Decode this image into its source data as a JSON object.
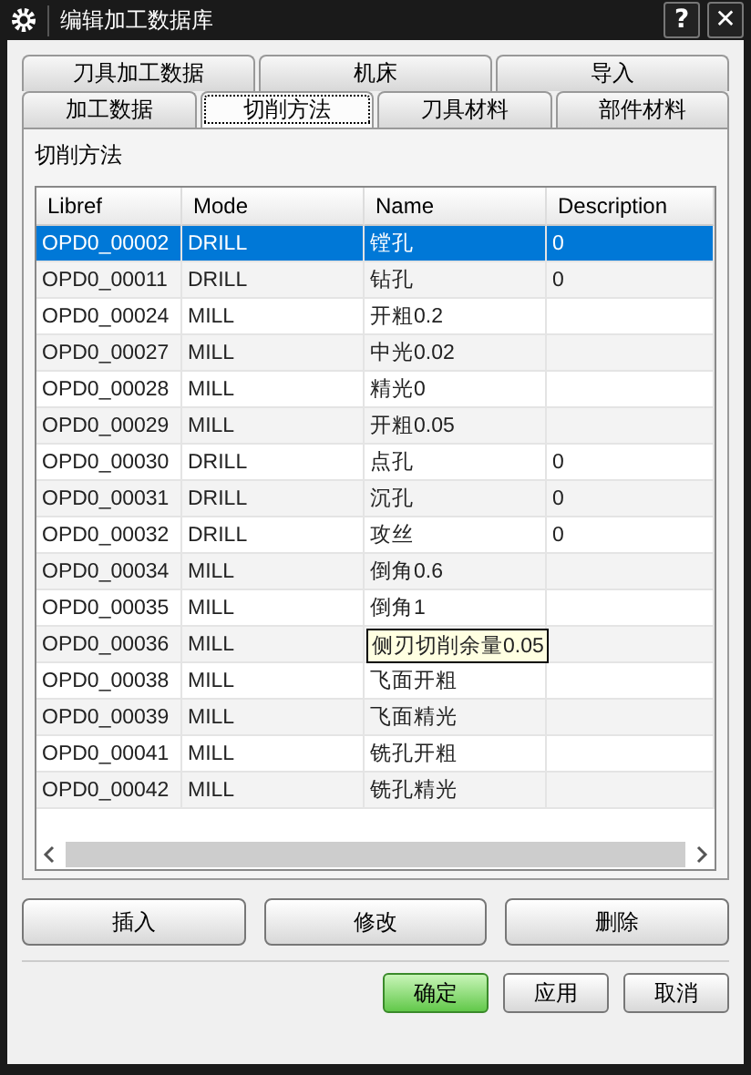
{
  "window": {
    "title": "编辑加工数据库",
    "help": "?",
    "close": "✕"
  },
  "tab_rows": [
    [
      {
        "label": "刀具加工数据",
        "selected": false
      },
      {
        "label": "机床",
        "selected": false
      },
      {
        "label": "导入",
        "selected": false
      }
    ],
    [
      {
        "label": "加工数据",
        "selected": false
      },
      {
        "label": "切削方法",
        "selected": true
      },
      {
        "label": "刀具材料",
        "selected": false
      },
      {
        "label": "部件材料",
        "selected": false
      }
    ]
  ],
  "group_label": "切削方法",
  "table": {
    "columns": [
      "Libref",
      "Mode",
      "Name",
      "Description"
    ],
    "rows": [
      {
        "cells": [
          "OPD0_00002",
          "DRILL",
          "镗孔",
          "0"
        ],
        "selected": true,
        "tooltip": false
      },
      {
        "cells": [
          "OPD0_00011",
          "DRILL",
          "钻孔",
          "0"
        ],
        "selected": false,
        "tooltip": false
      },
      {
        "cells": [
          "OPD0_00024",
          "MILL",
          "开粗0.2",
          ""
        ],
        "selected": false,
        "tooltip": false
      },
      {
        "cells": [
          "OPD0_00027",
          "MILL",
          "中光0.02",
          ""
        ],
        "selected": false,
        "tooltip": false
      },
      {
        "cells": [
          "OPD0_00028",
          "MILL",
          "精光0",
          ""
        ],
        "selected": false,
        "tooltip": false
      },
      {
        "cells": [
          "OPD0_00029",
          "MILL",
          "开粗0.05",
          ""
        ],
        "selected": false,
        "tooltip": false
      },
      {
        "cells": [
          "OPD0_00030",
          "DRILL",
          "点孔",
          "0"
        ],
        "selected": false,
        "tooltip": false
      },
      {
        "cells": [
          "OPD0_00031",
          "DRILL",
          "沉孔",
          "0"
        ],
        "selected": false,
        "tooltip": false
      },
      {
        "cells": [
          "OPD0_00032",
          "DRILL",
          "攻丝",
          "0"
        ],
        "selected": false,
        "tooltip": false
      },
      {
        "cells": [
          "OPD0_00034",
          "MILL",
          "倒角0.6",
          ""
        ],
        "selected": false,
        "tooltip": false
      },
      {
        "cells": [
          "OPD0_00035",
          "MILL",
          "倒角1",
          ""
        ],
        "selected": false,
        "tooltip": false
      },
      {
        "cells": [
          "OPD0_00036",
          "MILL",
          "侧刃切削余量0.05",
          ""
        ],
        "selected": false,
        "tooltip": true
      },
      {
        "cells": [
          "OPD0_00038",
          "MILL",
          "飞面开粗",
          ""
        ],
        "selected": false,
        "tooltip": false
      },
      {
        "cells": [
          "OPD0_00039",
          "MILL",
          "飞面精光",
          ""
        ],
        "selected": false,
        "tooltip": false
      },
      {
        "cells": [
          "OPD0_00041",
          "MILL",
          "铣孔开粗",
          ""
        ],
        "selected": false,
        "tooltip": false
      },
      {
        "cells": [
          "OPD0_00042",
          "MILL",
          "铣孔精光",
          ""
        ],
        "selected": false,
        "tooltip": false
      }
    ]
  },
  "action_buttons": [
    "插入",
    "修改",
    "删除"
  ],
  "dialog_buttons": [
    {
      "label": "确定",
      "default": true
    },
    {
      "label": "应用",
      "default": false
    },
    {
      "label": "取消",
      "default": false
    }
  ]
}
